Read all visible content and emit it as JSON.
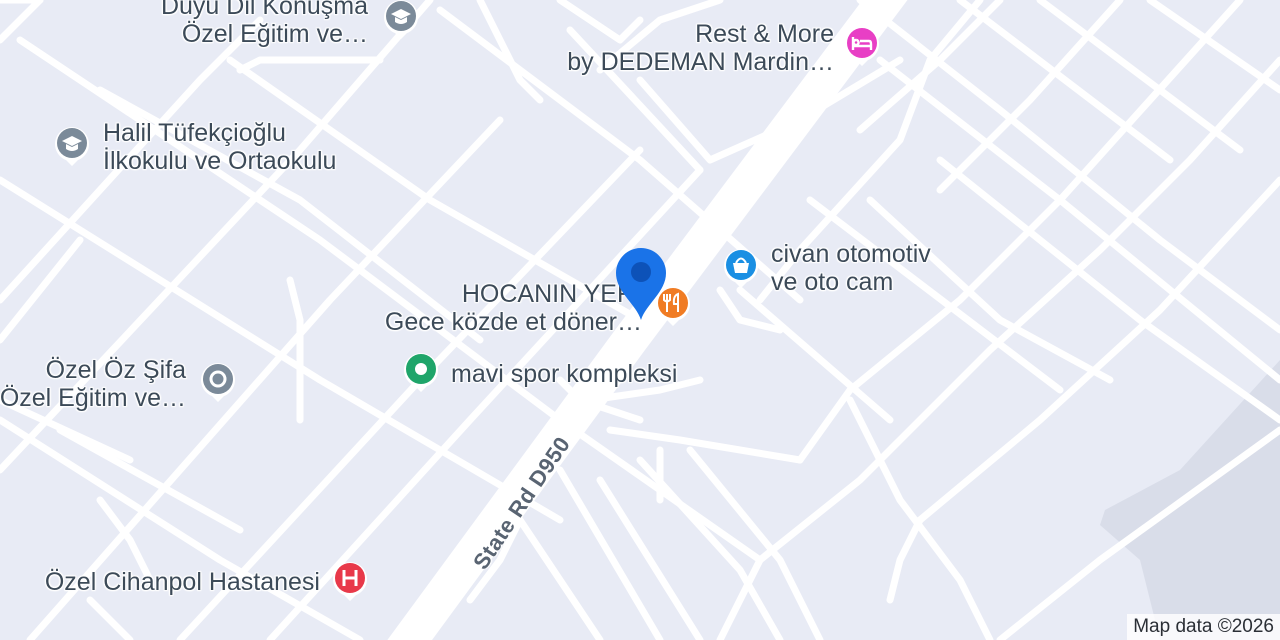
{
  "map": {
    "attribution": "Map data ©2026",
    "road_label": "State Rd D950"
  },
  "pois": [
    {
      "id": "duyu",
      "lines": [
        "Duyu Dil Konuşma",
        "Özel Eğitim ve…"
      ],
      "icon": "school-icon",
      "color": "#7b8a99"
    },
    {
      "id": "rest",
      "lines": [
        "Rest & More",
        "by DEDEMAN Mardin…"
      ],
      "icon": "hotel-icon",
      "color": "#e83fc5"
    },
    {
      "id": "halil",
      "lines": [
        "Halil Tüfekçioğlu",
        "İlkokulu ve Ortaokulu"
      ],
      "icon": "school-icon",
      "color": "#7b8a99"
    },
    {
      "id": "civan",
      "lines": [
        "civan otomotiv",
        "ve oto cam"
      ],
      "icon": "shopping-icon",
      "color": "#1a8fe3"
    },
    {
      "id": "hocanin",
      "lines": [
        "HOCANIN YERİ",
        "Gece közde et döner…"
      ],
      "icon": "restaurant-icon",
      "color": "#f07c24"
    },
    {
      "id": "mavi",
      "lines": [
        "mavi spor kompleksi"
      ],
      "icon": "park-icon",
      "color": "#1fa56a"
    },
    {
      "id": "oz",
      "lines": [
        "Özel Öz Şifa",
        "Özel Eğitim ve…"
      ],
      "icon": "place-icon",
      "color": "#7b8a99"
    },
    {
      "id": "cihanpol",
      "lines": [
        "Özel Cihanpol Hastanesi"
      ],
      "icon": "hospital-icon",
      "color": "#e8394a"
    }
  ],
  "marker": {
    "icon": "location-pin-icon",
    "color": "#1a73e8"
  }
}
